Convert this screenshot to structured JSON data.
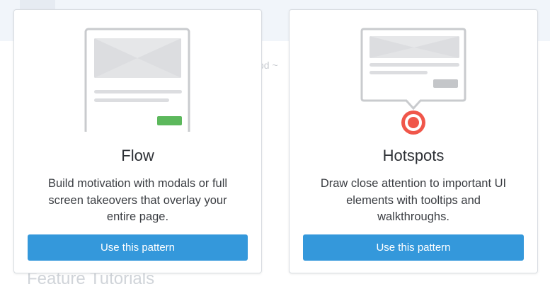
{
  "background": {
    "partial_text_1": "od ~",
    "heading": "Feature Tutorials"
  },
  "cards": [
    {
      "title": "Flow",
      "description": "Build motivation with modals or full screen takeovers that overlay your entire page.",
      "button_label": "Use this pattern",
      "illustration": "modal-illustration"
    },
    {
      "title": "Hotspots",
      "description": "Draw close attention to important UI elements with tooltips and walkthroughs.",
      "button_label": "Use this pattern",
      "illustration": "tooltip-hotspot-illustration"
    }
  ],
  "colors": {
    "primary_button": "#3498db",
    "accent_green": "#5cb85c",
    "hotspot_red": "#f0564a"
  }
}
